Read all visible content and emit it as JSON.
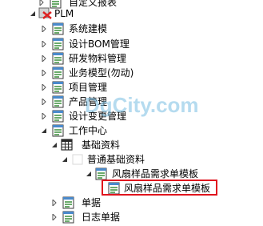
{
  "colors": {
    "selection_border": "#e0141e",
    "watermark": "#78bee1"
  },
  "watermark": "DgCity.com",
  "tree": {
    "items": [
      {
        "label": "自定义报表",
        "icon": "form-icon",
        "expander": "collapsed-arrow"
      },
      {
        "label": "PLM",
        "icon": "plm-root-icon",
        "expander": "expanded-arrow"
      },
      {
        "label": "系统建模",
        "icon": "form-icon",
        "expander": "collapsed-arrow"
      },
      {
        "label": "设计BOM管理",
        "icon": "form-icon",
        "expander": "collapsed-arrow"
      },
      {
        "label": "研发物料管理",
        "icon": "form-icon",
        "expander": "collapsed-arrow"
      },
      {
        "label": "业务模型(勿动)",
        "icon": "form-icon",
        "expander": "collapsed-arrow"
      },
      {
        "label": "项目管理",
        "icon": "form-icon",
        "expander": "collapsed-arrow"
      },
      {
        "label": "产品管理",
        "icon": "form-icon",
        "expander": "collapsed-arrow"
      },
      {
        "label": "设计变更管理",
        "icon": "form-icon",
        "expander": "collapsed-arrow"
      },
      {
        "label": "工作中心",
        "icon": "form-icon",
        "expander": "expanded-arrow"
      },
      {
        "label": "基础资料",
        "icon": "grid-icon",
        "expander": "expanded-arrow"
      },
      {
        "label": "普通基础资料",
        "icon": "blank-icon",
        "expander": "expanded-arrow"
      },
      {
        "label": "风扇样品需求单模板",
        "icon": "form-icon",
        "expander": "expanded-arrow"
      },
      {
        "label": "风扇样品需求单模板",
        "icon": "form-icon",
        "expander": "none",
        "selected": true
      },
      {
        "label": "单据",
        "icon": "form-icon",
        "expander": "collapsed-arrow"
      },
      {
        "label": "日志单据",
        "icon": "form-icon",
        "expander": "collapsed-arrow"
      }
    ]
  }
}
